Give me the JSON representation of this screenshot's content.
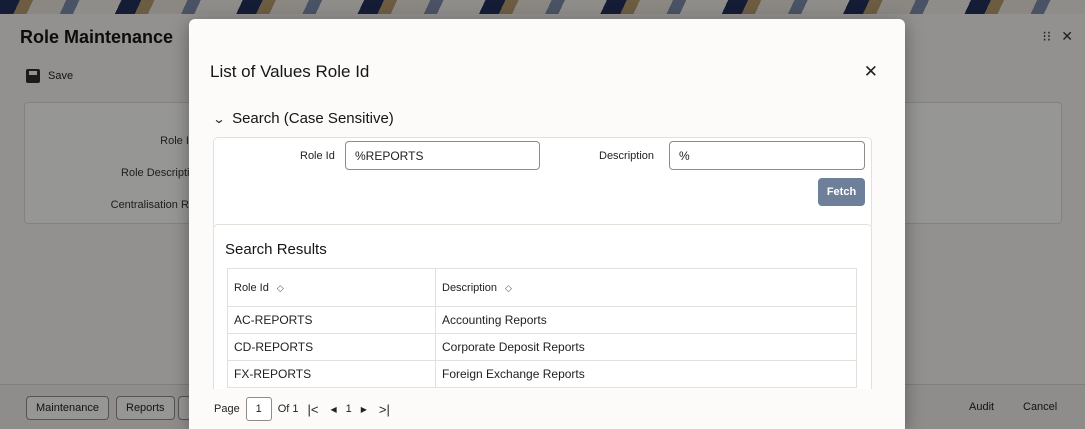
{
  "background": {
    "title": "Role Maintenance",
    "save_label": "Save",
    "fields": [
      "Role Id",
      "Role Descriptic",
      "Centralisation Ro"
    ],
    "footer_buttons": [
      "Maintenance",
      "Reports"
    ],
    "footer_right_buttons": [
      "Audit",
      "Cancel"
    ]
  },
  "modal": {
    "title": "List of Values Role Id",
    "search_section_label": "Search (Case Sensitive)",
    "role_id_label": "Role Id",
    "role_id_value": "%REPORTS",
    "description_label": "Description",
    "description_value": "%",
    "fetch_label": "Fetch",
    "results_title": "Search Results",
    "columns": [
      "Role Id",
      "Description"
    ],
    "rows": [
      {
        "role_id": "AC-REPORTS",
        "description": "Accounting Reports"
      },
      {
        "role_id": "CD-REPORTS",
        "description": "Corporate Deposit Reports"
      },
      {
        "role_id": "FX-REPORTS",
        "description": "Foreign Exchange Reports"
      }
    ],
    "pager": {
      "page_label": "Page",
      "page_value": "1",
      "of_label": "Of 1",
      "current_page": "1"
    }
  }
}
